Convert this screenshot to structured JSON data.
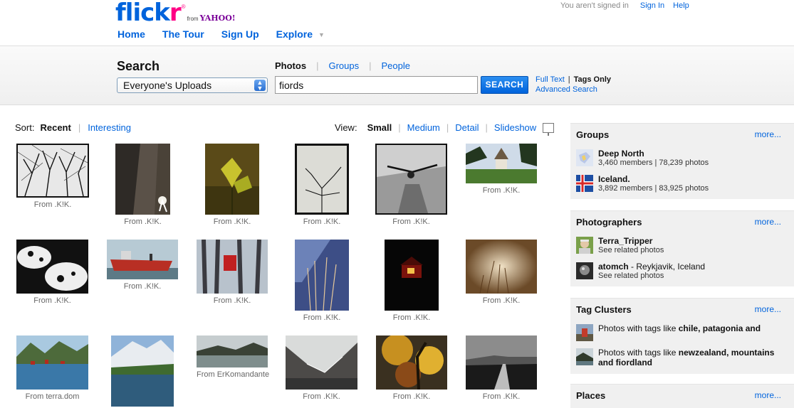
{
  "header": {
    "logo": {
      "flick": "flick",
      "r": "r",
      "reg": "®",
      "from": "from",
      "yahoo": "YAHOO!"
    },
    "nav": [
      "Home",
      "The Tour",
      "Sign Up",
      "Explore"
    ],
    "user": {
      "status": "You aren't signed in",
      "sign_in": "Sign In",
      "help": "Help"
    }
  },
  "search": {
    "title": "Search",
    "scope": "Everyone's Uploads",
    "tabs": {
      "photos": "Photos",
      "groups": "Groups",
      "people": "People"
    },
    "query": "fiords",
    "button": "SEARCH",
    "full_text": "Full Text",
    "sep": "|",
    "tags_only": "Tags Only",
    "advanced": "Advanced Search"
  },
  "sort": {
    "label": "Sort:",
    "recent": "Recent",
    "interesting": "Interesting"
  },
  "view": {
    "label": "View:",
    "small": "Small",
    "medium": "Medium",
    "detail": "Detail",
    "slideshow": "Slideshow"
  },
  "photos": [
    {
      "caption": "From .K!K."
    },
    {
      "caption": "From .K!K."
    },
    {
      "caption": "From .K!K."
    },
    {
      "caption": "From .K!K."
    },
    {
      "caption": "From .K!K."
    },
    {
      "caption": "From .K!K."
    },
    {
      "caption": "From .K!K."
    },
    {
      "caption": "From .K!K."
    },
    {
      "caption": "From .K!K."
    },
    {
      "caption": "From .K!K."
    },
    {
      "caption": "From .K!K."
    },
    {
      "caption": "From .K!K."
    },
    {
      "caption": "From terra.dom"
    },
    {
      "caption": ""
    },
    {
      "caption": "From ErKomandante"
    },
    {
      "caption": "From .K!K."
    },
    {
      "caption": "From .K!K."
    },
    {
      "caption": "From .K!K."
    }
  ],
  "sidebar": {
    "groups": {
      "title": "Groups",
      "more": "more...",
      "items": [
        {
          "name": "Deep North",
          "stats": "3,460 members | 78,239 photos"
        },
        {
          "name": "Iceland.",
          "stats": "3,892 members | 83,925 photos"
        }
      ]
    },
    "photographers": {
      "title": "Photographers",
      "more": "more...",
      "items": [
        {
          "name": "Terra_Tripper",
          "location": "",
          "sub": "See related photos"
        },
        {
          "name": "atomch",
          "location": " - Reykjavik, Iceland",
          "sub": "See related photos"
        }
      ]
    },
    "tag_clusters": {
      "title": "Tag Clusters",
      "more": "more...",
      "items": [
        {
          "prefix": "Photos with tags like ",
          "tags": "chile, patagonia and"
        },
        {
          "prefix": "Photos with tags like ",
          "tags": "newzealand, mountains",
          "line2": "and fiordland"
        }
      ]
    },
    "places": {
      "title": "Places",
      "more": "more..."
    }
  }
}
